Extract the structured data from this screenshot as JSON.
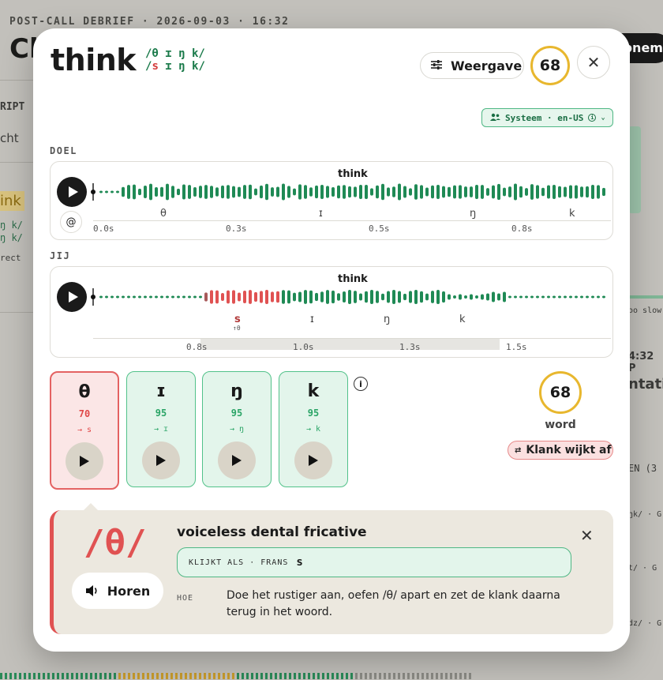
{
  "background": {
    "header": "POST-CALL DEBRIEF · 2026-09-03 · 16:32",
    "title": "Cl",
    "record_button": "Opnemen",
    "left_texts": [
      "RIPT",
      "cht",
      "ink",
      "ŋ k/",
      "ŋ k/",
      "rect"
    ],
    "right_texts": [
      "oo slow",
      "4:32 P",
      "ntatie",
      "EN (3",
      "ŋk/ · G",
      "t/ · G",
      "dz/ · G"
    ]
  },
  "modal": {
    "word": "think",
    "ipa_target": "/θ ɪ ŋ k/",
    "ipa_user_prefix": "/",
    "ipa_user_bad": "s",
    "ipa_user_rest": " ɪ ŋ k/",
    "view_button": "Weergave",
    "score": "68",
    "voice_selector": "Systeem · en-US",
    "target_label": "DOEL",
    "user_label": "JIJ",
    "target_wave": {
      "word": "think",
      "phonemes": [
        "θ",
        "ɪ",
        "ŋ",
        "k"
      ],
      "ticks": [
        "0.0s",
        "0.3s",
        "0.5s",
        "0.8s"
      ]
    },
    "user_wave": {
      "word": "think",
      "phonemes": [
        "s",
        "ɪ",
        "ŋ",
        "k"
      ],
      "sub_marker": "↑θ",
      "ticks": [
        "0.8s",
        "1.0s",
        "1.3s",
        "1.5s"
      ]
    },
    "tiles": [
      {
        "symbol": "θ",
        "score": "70",
        "heard": "→ s",
        "status": "bad"
      },
      {
        "symbol": "ɪ",
        "score": "95",
        "heard": "→ ɪ",
        "status": "good"
      },
      {
        "symbol": "ŋ",
        "score": "95",
        "heard": "→ ŋ",
        "status": "good"
      },
      {
        "symbol": "k",
        "score": "95",
        "heard": "→ k",
        "status": "good"
      }
    ],
    "word_score": "68",
    "word_label": "word",
    "deviation_badge": "Klank wijkt af",
    "detail": {
      "symbol": "/θ/",
      "listen_button": "Horen",
      "description": "voiceless dental fricative",
      "sounds_like_label": "KLIJKT ALS · FRANS",
      "sounds_like_value": "s",
      "how_label": "HOE",
      "how_text": "Doe het rustiger aan, oefen /θ/ apart en zet de klank daarna terug in het woord."
    }
  },
  "colors": {
    "good": "#1f8a55",
    "bad": "#e05252",
    "score_ring": "#e8b72e"
  }
}
